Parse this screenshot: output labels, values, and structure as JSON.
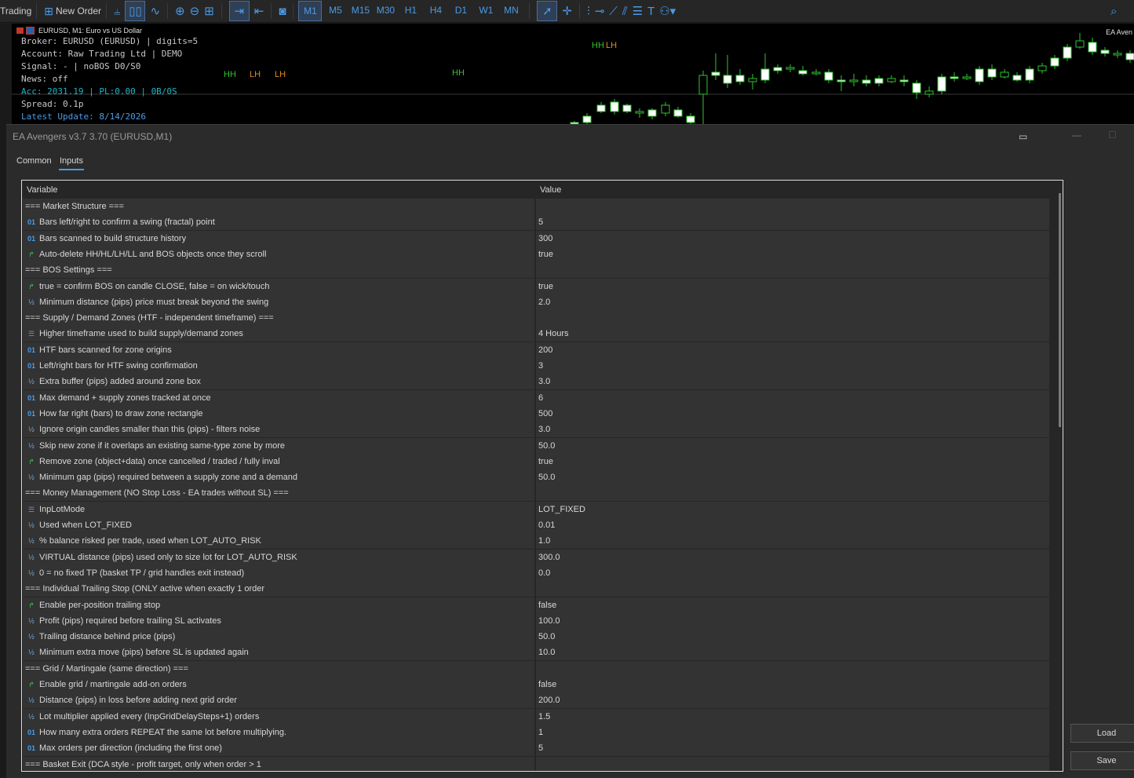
{
  "toolbar": {
    "trading_label": "Trading",
    "new_order_label": "New Order",
    "timeframes": [
      "M1",
      "M5",
      "M15",
      "M30",
      "H1",
      "H4",
      "D1",
      "W1",
      "MN"
    ],
    "active_timeframe": "M1"
  },
  "chart": {
    "symbol_title": "EURUSD, M1:  Euro vs US Dollar",
    "right_label": "EA Aven",
    "info_lines": [
      "Broker: EURUSD (EURUSD) | digits=5",
      "Account: Raw Trading Ltd | DEMO",
      "Signal: - | noBOS D0/S0",
      "News: off",
      "Acc: 2031.19 | PL:0.00 | 0B/0S",
      "Spread: 0.1p",
      "Latest Update: 8/14/2026"
    ],
    "swing_labels": [
      {
        "text": "HH",
        "color": "#2fc52f"
      },
      {
        "text": "LH",
        "color": "#e08a1e"
      },
      {
        "text": "LH",
        "color": "#e08a1e"
      },
      {
        "text": "HH",
        "color": "#2fc52f"
      },
      {
        "text": "HH",
        "color": "#2fc52f"
      },
      {
        "text": "LH",
        "color": "#e08a1e"
      }
    ]
  },
  "dialog": {
    "title": "EA Avengers v3.7 3.70 (EURUSD,M1)",
    "tabs": [
      "Common",
      "Inputs"
    ],
    "active_tab": "Inputs",
    "columns": [
      "Variable",
      "Value"
    ],
    "rows": [
      {
        "icon": "none",
        "name": "=== Market Structure ===",
        "value": ""
      },
      {
        "icon": "int",
        "name": "Bars left/right to confirm a swing (fractal) point",
        "value": "5"
      },
      {
        "icon": "int",
        "name": "Bars scanned to build structure history",
        "value": "300"
      },
      {
        "icon": "bool",
        "name": "Auto-delete HH/HL/LH/LL and BOS objects once they scroll",
        "value": "true"
      },
      {
        "icon": "none",
        "name": "=== BOS Settings ===",
        "value": ""
      },
      {
        "icon": "bool",
        "name": "true = confirm BOS on candle CLOSE, false = on wick/touch",
        "value": "true"
      },
      {
        "icon": "dbl",
        "name": "Minimum distance (pips) price must break beyond the swing",
        "value": "2.0"
      },
      {
        "icon": "none",
        "name": "=== Supply / Demand Zones (HTF - independent timeframe) ===",
        "value": ""
      },
      {
        "icon": "enum",
        "name": "Higher timeframe used to build supply/demand zones",
        "value": "4 Hours"
      },
      {
        "icon": "int",
        "name": "HTF bars scanned for zone origins",
        "value": "200"
      },
      {
        "icon": "int",
        "name": "Left/right bars for HTF swing confirmation",
        "value": "3"
      },
      {
        "icon": "dbl",
        "name": "Extra buffer (pips) added around zone box",
        "value": "3.0"
      },
      {
        "icon": "int",
        "name": "Max demand + supply zones tracked at once",
        "value": "6"
      },
      {
        "icon": "int",
        "name": "How far right (bars) to draw zone rectangle",
        "value": "500"
      },
      {
        "icon": "dbl",
        "name": "Ignore origin candles smaller than this (pips) - filters noise",
        "value": "3.0"
      },
      {
        "icon": "dbl",
        "name": "Skip new zone if it overlaps an existing same-type zone by more",
        "value": "50.0"
      },
      {
        "icon": "bool",
        "name": "Remove zone (object+data) once cancelled / traded / fully inval",
        "value": "true"
      },
      {
        "icon": "dbl",
        "name": "Minimum gap (pips) required between a supply zone and a demand",
        "value": "50.0"
      },
      {
        "icon": "none",
        "name": "=== Money Management (NO Stop Loss - EA trades without SL) ===",
        "value": ""
      },
      {
        "icon": "enum",
        "name": "InpLotMode",
        "value": "LOT_FIXED"
      },
      {
        "icon": "dbl",
        "name": "Used when LOT_FIXED",
        "value": "0.01"
      },
      {
        "icon": "dbl",
        "name": "% balance risked per trade, used when LOT_AUTO_RISK",
        "value": "1.0"
      },
      {
        "icon": "dbl",
        "name": "VIRTUAL distance (pips) used only to size lot for LOT_AUTO_RISK",
        "value": "300.0"
      },
      {
        "icon": "dbl",
        "name": "0 = no fixed TP (basket TP / grid handles exit instead)",
        "value": "0.0"
      },
      {
        "icon": "none",
        "name": "=== Individual Trailing Stop (ONLY active when exactly 1 order",
        "value": ""
      },
      {
        "icon": "bool",
        "name": "Enable per-position trailing stop",
        "value": "false"
      },
      {
        "icon": "dbl",
        "name": "Profit (pips) required before trailing SL activates",
        "value": "100.0"
      },
      {
        "icon": "dbl",
        "name": "Trailing distance behind price (pips)",
        "value": "50.0"
      },
      {
        "icon": "dbl",
        "name": "Minimum extra move (pips) before SL is updated again",
        "value": "10.0"
      },
      {
        "icon": "none",
        "name": "=== Grid / Martingale (same direction) ===",
        "value": ""
      },
      {
        "icon": "bool",
        "name": "Enable grid / martingale add-on orders",
        "value": "false"
      },
      {
        "icon": "dbl",
        "name": "Distance (pips) in loss before adding next grid order",
        "value": "200.0"
      },
      {
        "icon": "dbl",
        "name": "Lot multiplier applied every (InpGridDelaySteps+1) orders",
        "value": "1.5"
      },
      {
        "icon": "int",
        "name": "How many extra orders REPEAT the same lot before multiplying.",
        "value": "1"
      },
      {
        "icon": "int",
        "name": "Max orders per direction (including the first one)",
        "value": "5"
      },
      {
        "icon": "none",
        "name": "=== Basket Exit (DCA style - profit target, only when order > 1",
        "value": ""
      }
    ],
    "load_label": "Load",
    "save_label": "Save"
  },
  "icon_glyphs": {
    "int": "01",
    "dbl": "½",
    "bool": "↱",
    "enum": "☰",
    "none": ""
  },
  "colors": {
    "bull_candle": "#ffffff",
    "bear_candle": "#2fc52f",
    "accent": "#4a9be8"
  }
}
